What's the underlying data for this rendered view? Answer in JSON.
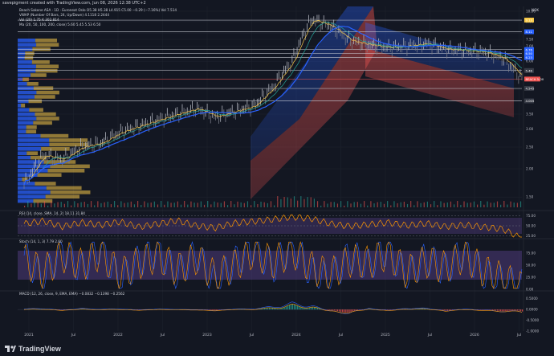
{
  "header": {
    "text": "savepigment created with TradingView.com, Jun 08, 2026 12:38 UTC+2"
  },
  "legends": {
    "main": "Beach Sakone ASA · 1D · Euronext Oslo  O5.38 H5.38 L4.915 C5.00 −0.29 (−7.16%)  Vol 7.514",
    "vwap": "VWAP (Number Of Bars, 24, Up/Down)  4.1118  2.2444",
    "vol": "Vol (20)  1.75 K  302.814",
    "ma": "Ma (20, 50, 100, 200, close)  5.60  5.45  5.53  6.50",
    "rsi": "RSI (14, close, SMA, 14, 2)  18.11  31.84",
    "stoch": "Stoch (14, 1, 3)  7.79  2.60",
    "macd": "MACD (12, 26, close, 9, EMA, EMA)  −0.0832  −0.1398  −0.2562"
  },
  "currency": "NOK",
  "branding": "TradingView",
  "colors": {
    "background": "#131722",
    "price": "#b2b5be",
    "ma20": "#f7c948",
    "ma50": "#26a69a",
    "ma100": "#2962ff",
    "channel_blue": "#2962ff",
    "channel_red": "#ef5350",
    "rsi": "#ff9800",
    "stoch_k": "#2962ff",
    "stoch_d": "#ff9800",
    "band": "#7e57c2"
  },
  "chart_data": [
    {
      "type": "line",
      "panel": "price",
      "y_scale": "log",
      "ylim": [
        1.35,
        10.5
      ],
      "x_ticks": [
        "2021",
        "Jul",
        "2022",
        "Jul",
        "2023",
        "Jul",
        "2024",
        "Jul",
        "2025",
        "Jul",
        "2026",
        "Jul"
      ],
      "y_ticks": [
        1.5,
        2.0,
        2.5,
        3.0,
        3.5,
        4.0,
        4.5,
        5.0,
        5.5,
        6.0,
        6.5,
        7.0,
        7.5,
        8.0,
        9.0,
        10.0
      ],
      "price_tags": [
        {
          "label": "9.13",
          "value": 9.13,
          "color": "#f7c948"
        },
        {
          "label": "8.11",
          "value": 8.11,
          "color": "#2962ff"
        },
        {
          "label": "6.76",
          "value": 6.76,
          "color": "#2962ff"
        },
        {
          "label": "6.50",
          "value": 6.5,
          "color": "#2962ff"
        },
        {
          "label": "6.23",
          "value": 6.23,
          "color": "#2962ff"
        },
        {
          "label": "5.46",
          "value": 5.46,
          "color": "#b2b5be"
        },
        {
          "label": "BEACH 5.00",
          "value": 5.0,
          "color": "#ef5350"
        },
        {
          "label": "4.545",
          "value": 4.545,
          "color": "#b2b5be"
        },
        {
          "label": "4.005",
          "value": 4.005,
          "color": "#b2b5be"
        }
      ],
      "series": [
        {
          "name": "Close",
          "x": [
            "2021-01",
            "2021-04",
            "2021-07",
            "2021-10",
            "2022-01",
            "2022-04",
            "2022-07",
            "2022-10",
            "2023-01",
            "2023-04",
            "2023-07",
            "2023-10",
            "2024-01",
            "2024-04",
            "2024-06",
            "2024-08",
            "2024-10",
            "2024-12",
            "2025-02",
            "2025-04",
            "2025-06",
            "2025-08",
            "2025-10",
            "2025-12",
            "2026-02",
            "2026-04",
            "2026-06"
          ],
          "values": [
            1.7,
            2.3,
            2.2,
            2.5,
            2.6,
            2.9,
            3.1,
            3.3,
            3.5,
            3.7,
            3.4,
            3.6,
            3.8,
            4.6,
            6.0,
            9.2,
            8.6,
            7.4,
            7.1,
            6.9,
            7.0,
            7.2,
            6.8,
            6.7,
            6.6,
            6.2,
            5.0
          ]
        }
      ]
    },
    {
      "type": "line",
      "panel": "rsi",
      "ylim": [
        20,
        80
      ],
      "y_ticks": [
        25.0,
        50.0,
        75.0
      ],
      "series": [
        {
          "name": "RSI",
          "values": [
            55,
            62,
            48,
            58,
            52,
            60,
            47,
            55,
            63,
            50,
            45,
            57,
            61,
            66,
            72,
            68,
            55,
            49,
            53,
            58,
            51,
            56,
            48,
            52,
            47,
            42,
            18
          ]
        }
      ]
    },
    {
      "type": "line",
      "panel": "stoch",
      "ylim": [
        0,
        100
      ],
      "y_ticks": [
        0.0,
        25.0,
        50.0,
        75.0
      ],
      "series": [
        {
          "name": "%K",
          "values": [
            70,
            20,
            85,
            40,
            90,
            15,
            60,
            80,
            30,
            75,
            10,
            55,
            88,
            45,
            92,
            35,
            20,
            70,
            50,
            85,
            25,
            65,
            40,
            80,
            30,
            15,
            8
          ]
        },
        {
          "name": "%D",
          "values": [
            60,
            35,
            70,
            50,
            75,
            30,
            55,
            70,
            40,
            65,
            25,
            50,
            78,
            55,
            80,
            45,
            30,
            60,
            55,
            75,
            35,
            58,
            45,
            70,
            38,
            22,
            3
          ]
        }
      ]
    },
    {
      "type": "bar",
      "panel": "macd",
      "ylim": [
        -1.0,
        0.75
      ],
      "y_ticks": [
        -1.0,
        -0.5,
        0.0,
        0.5
      ],
      "series": [
        {
          "name": "Histogram",
          "values": [
            0.02,
            0.05,
            -0.03,
            0.04,
            0.01,
            0.03,
            -0.02,
            0.02,
            0.01,
            -0.01,
            -0.04,
            0.02,
            0.03,
            0.12,
            0.25,
            0.18,
            -0.1,
            -0.15,
            0.04,
            -0.05,
            0.06,
            0.05,
            -0.06,
            0.03,
            -0.04,
            -0.08,
            -0.12
          ]
        }
      ]
    }
  ]
}
